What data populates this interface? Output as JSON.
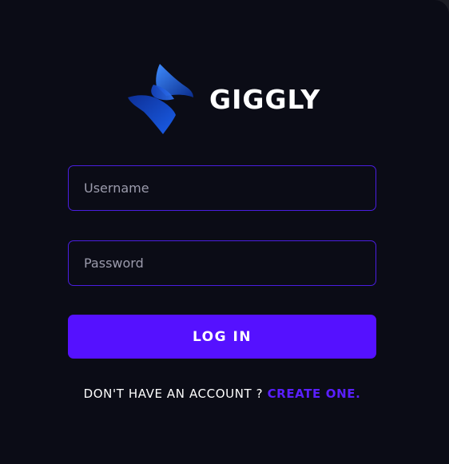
{
  "brand": {
    "name": "GIGGLY",
    "logo_icon": "giggly-logo-icon",
    "logo_colors": [
      "#0a2c8a",
      "#1a5ee8",
      "#3f8cff"
    ]
  },
  "login_form": {
    "username": {
      "value": "",
      "placeholder": "Username"
    },
    "password": {
      "value": "",
      "placeholder": "Password"
    },
    "submit_label": "LOG IN"
  },
  "signup": {
    "prompt": "DON'T HAVE AN ACCOUNT ? ",
    "link_label": "CREATE ONE."
  },
  "colors": {
    "background": "#0b0c16",
    "accent": "#5511ff",
    "field_border": "#4a1ee0",
    "link": "#5a1fff",
    "text": "#ffffff"
  }
}
